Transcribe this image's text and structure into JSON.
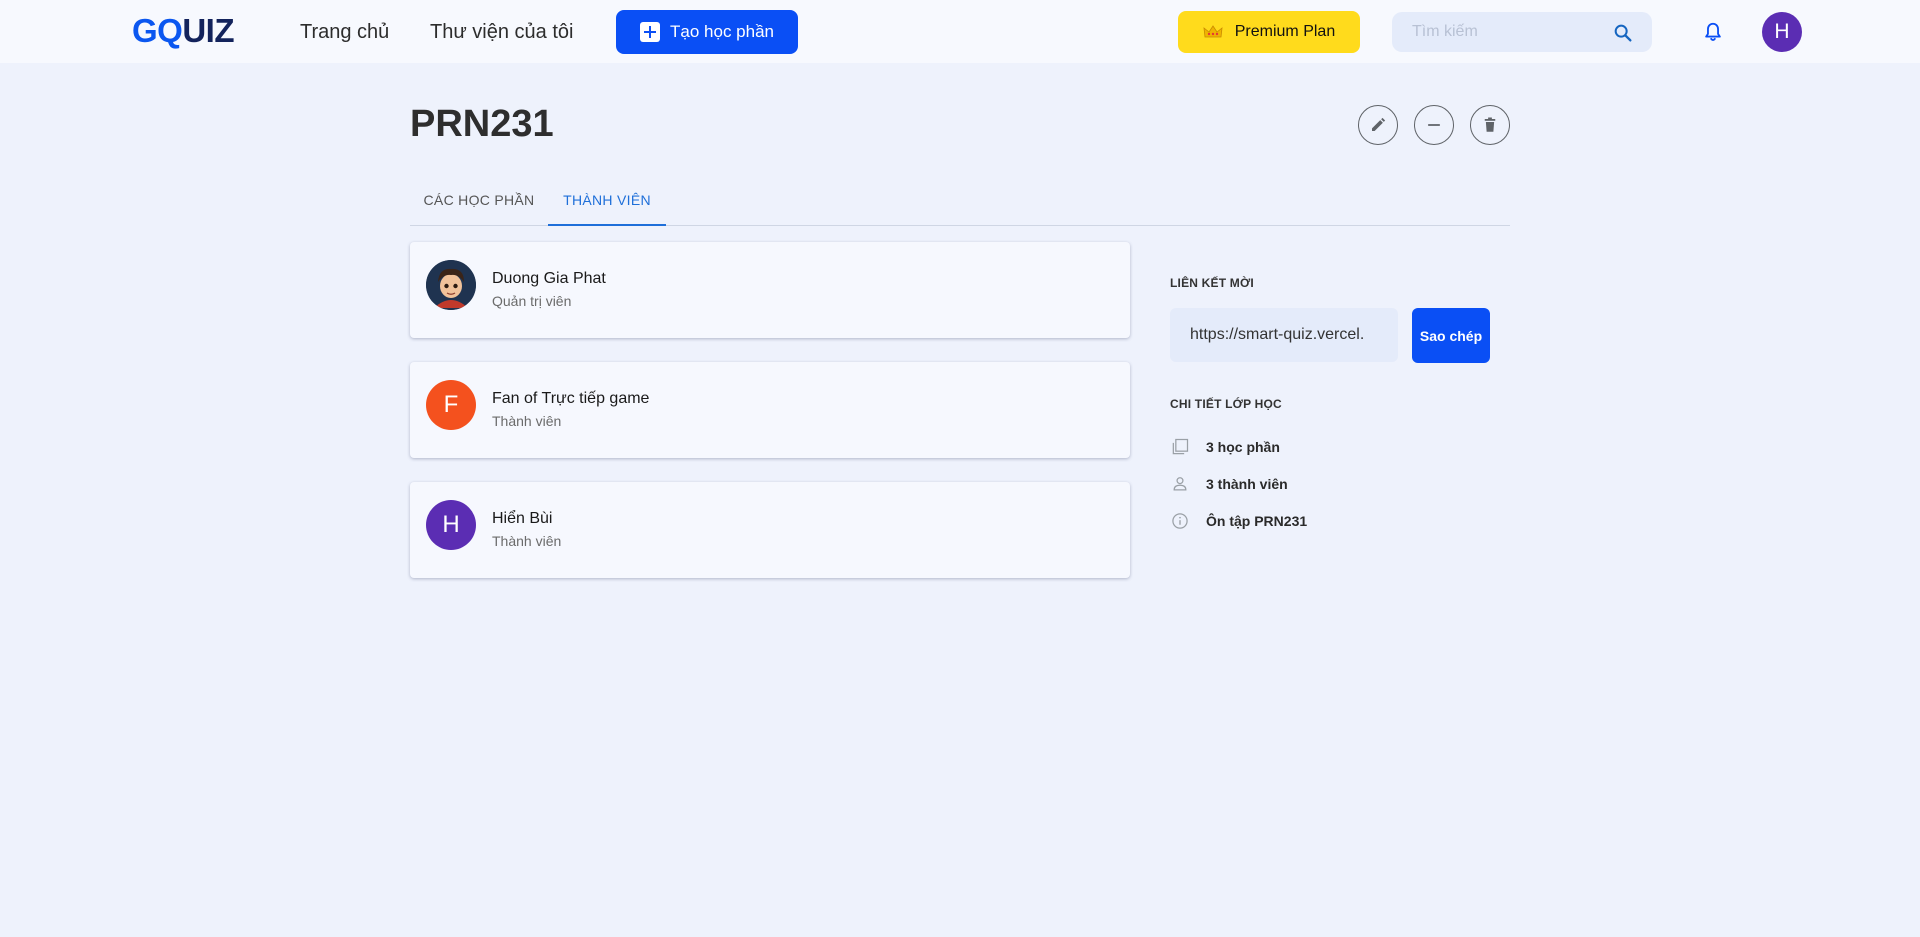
{
  "header": {
    "logo_part1": "GQ",
    "logo_part2": "UIZ",
    "nav": {
      "home": "Trang chủ",
      "library": "Thư viện của tôi"
    },
    "create_label": "Tạo học phần",
    "premium_label": "Premium Plan",
    "search_placeholder": "Tìm kiếm",
    "user_initial": "H"
  },
  "page": {
    "title": "PRN231"
  },
  "tabs": [
    {
      "label": "CÁC HỌC PHẦN",
      "active": false
    },
    {
      "label": "THÀNH VIÊN",
      "active": true
    }
  ],
  "members": [
    {
      "name": "Duong Gia Phat",
      "role": "Quản trị viên",
      "avatar": "image"
    },
    {
      "name": "Fan of Trực tiếp game",
      "role": "Thành viên",
      "initial": "F",
      "color": "#f4511e"
    },
    {
      "name": "Hiển Bùi",
      "role": "Thành viên",
      "initial": "H",
      "color": "#5b2db3"
    }
  ],
  "sidebar": {
    "invite_label": "LIÊN KẾT MỜI",
    "invite_link": "https://smart-quiz.vercel.",
    "copy_label": "Sao chép",
    "details_label": "CHI TIẾT LỚP HỌC",
    "details": [
      {
        "icon": "copy-stack-icon",
        "text": "3 học phần"
      },
      {
        "icon": "person-icon",
        "text": "3 thành viên"
      },
      {
        "icon": "info-icon",
        "text": "Ôn tập PRN231"
      }
    ]
  },
  "colors": {
    "primary": "#0a4ff5",
    "premium": "#ffdb1c",
    "background": "#eef2fc",
    "tab_active": "#1e6fd9"
  }
}
